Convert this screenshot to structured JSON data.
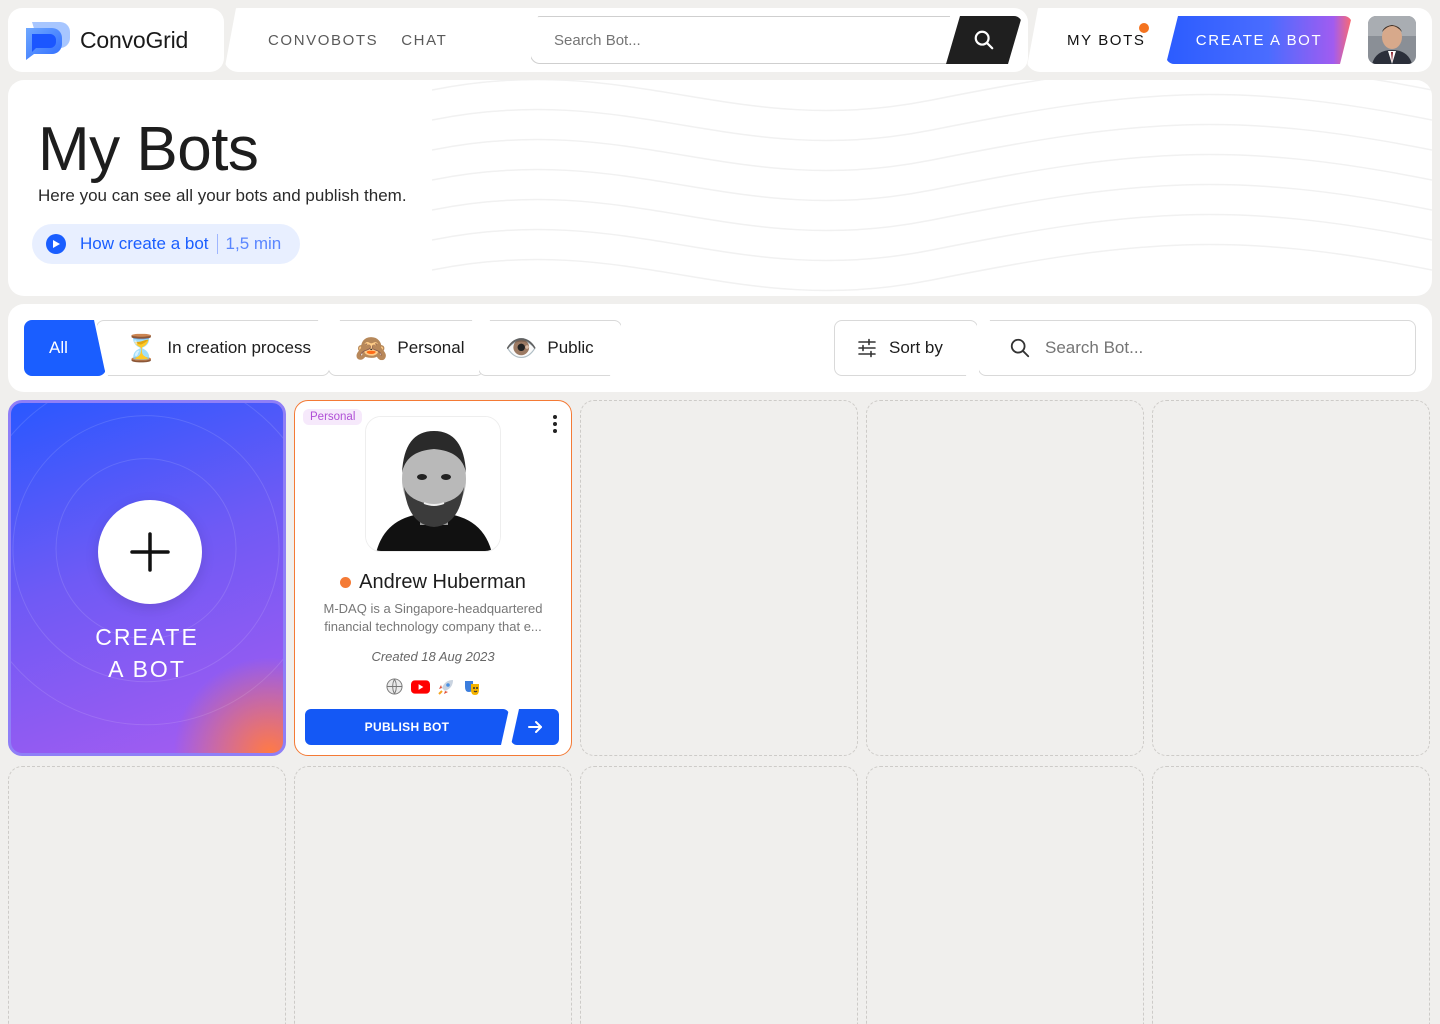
{
  "app": {
    "name": "ConvoGrid"
  },
  "nav": {
    "items": [
      "CONVOBOTS",
      "CHAT"
    ],
    "my_bots": "MY BOTS",
    "create_bot": "CREATE A BOT"
  },
  "search": {
    "placeholder": "Search Bot..."
  },
  "hero": {
    "title": "My Bots",
    "subtitle": "Here you can see all your bots and publish them.",
    "howto_label": "How create a bot",
    "howto_duration": "1,5 min"
  },
  "filters": {
    "tabs": [
      {
        "label": "All",
        "emoji": ""
      },
      {
        "label": "In creation process",
        "emoji": "⏳"
      },
      {
        "label": "Personal",
        "emoji": "🙈"
      },
      {
        "label": "Public",
        "emoji": "👁️"
      }
    ],
    "sort_label": "Sort by",
    "search_placeholder": "Search Bot..."
  },
  "create_card": {
    "line1": "CREATE",
    "line2": "A BOT"
  },
  "bot": {
    "badge": "Personal",
    "name": "Andrew Huberman",
    "desc_line1": "M-DAQ is a Singapore-headquartered",
    "desc_line2": "financial technology company that e...",
    "created": "Created 18 Aug 2023",
    "icons": [
      "globe-icon",
      "youtube-icon",
      "rocket-icon",
      "theater-icon"
    ],
    "publish_label": "PUBLISH BOT"
  },
  "colors": {
    "primary": "#1a5eff",
    "accent_orange": "#f4731f",
    "badge_purple": "#b04fd6"
  }
}
